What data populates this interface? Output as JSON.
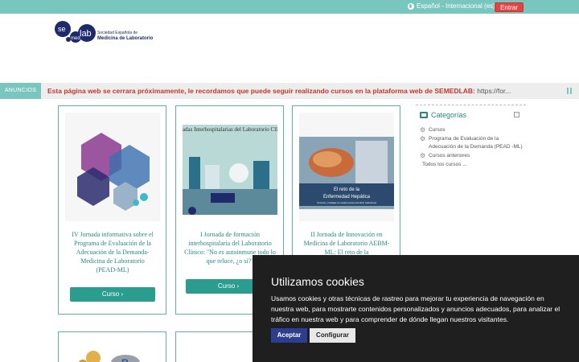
{
  "topbar": {
    "language": "Español - Internacional (es)",
    "login_label": "Entrar"
  },
  "logo": {
    "se": "se",
    "med": "med",
    "lab": "lab",
    "line1": "Sociedad Española de",
    "line2": "Medicina de Laboratorio"
  },
  "announcement": {
    "label": "ANUNCIOS",
    "text": "Esta página web se cerrara próximamente, le recordamos que puede seguir realizando cursos en la plataforma web de SEMEDLAB: ",
    "link": "https://for..."
  },
  "courses": [
    {
      "title": "IV Jornada informativa sobre el Programa de Evaluación de la Adecuación de la Demanda- Medicina de Laboratorio (PEAD-ML)",
      "button": "Curso ›"
    },
    {
      "title": "I Jornada de formación interhospitalaria del Laboratorio Clínico: \"No es autoinmune todo lo que reluce, ¿o sí?\"",
      "image_heading": "Jornadas Interhospitalarias del Laboratorio Clínico",
      "button": "Curso ›"
    },
    {
      "title": "II Jornada de Innovación en Medicina de Laboratorio AEBM-ML: El reto de la",
      "image_caption_1": "El reto de la",
      "image_caption_2": "Enfermedad Hepática",
      "image_caption_3": "Conocer y trabajar en equipo para encontrar soluciones"
    }
  ],
  "sidebar": {
    "title": "Categorías",
    "items": [
      "Cursos",
      "Programa de Evaluación de la Adecuación de la Demanda (PEAD -ML)",
      "Cursos anteriores"
    ],
    "all_courses": "Todos los cursos ..."
  },
  "cookie": {
    "title": "Utilizamos cookies",
    "text": "Usamos cookies y otras técnicas de rastreo para mejorar tu experiencia de navegación en nuestra web, para mostrarte contenidos personalizados y anuncios adecuados, para analizar el tráfico en nuestra web y para comprender de dónde llegan nuestros visitantes.",
    "accept": "Aceptar",
    "configure": "Configurar"
  },
  "colors": {
    "teal": "#79c6bf",
    "teal_dark": "#2a9d8f",
    "announcement_red": "#c0392b",
    "login_red": "#e24343",
    "logo_navy": "#1f2a6b"
  }
}
